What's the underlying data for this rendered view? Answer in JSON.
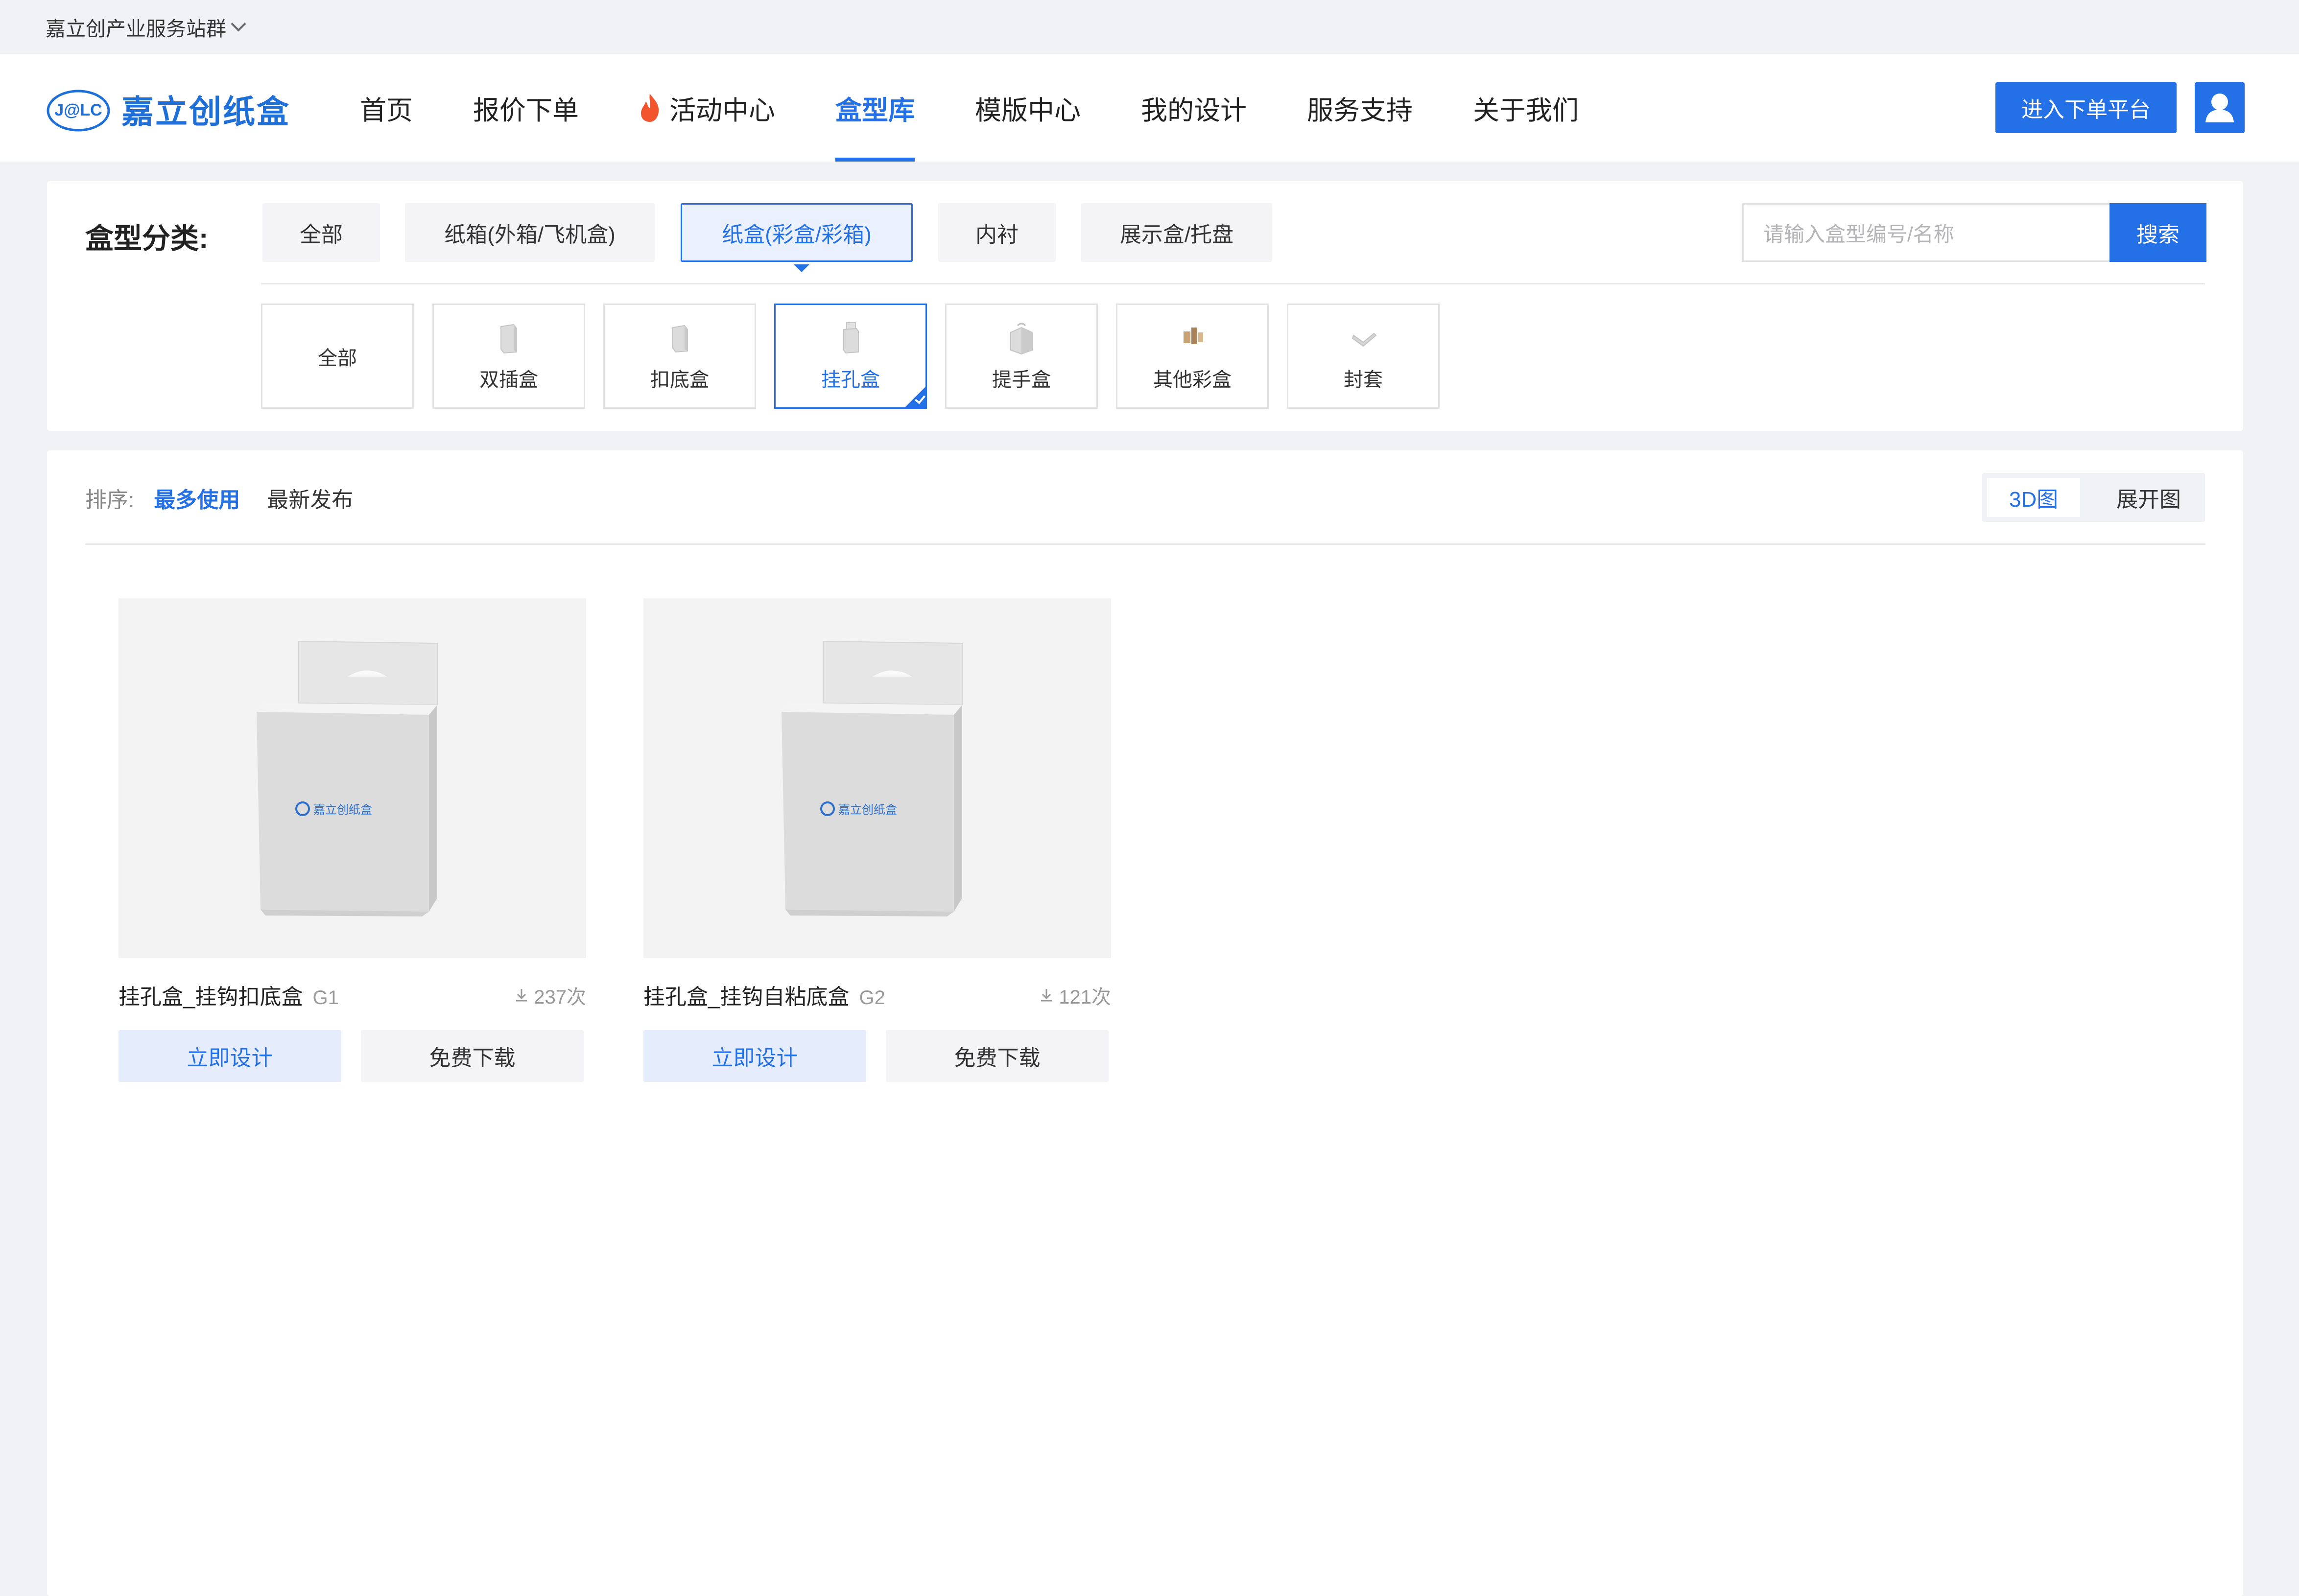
{
  "topbar": {
    "site_group": "嘉立创产业服务站群"
  },
  "brand": {
    "logo_text": "嘉立创纸盒",
    "logo_mark": "J@LC"
  },
  "nav": {
    "items": [
      "首页",
      "报价下单",
      "活动中心",
      "盒型库",
      "模版中心",
      "我的设计",
      "服务支持",
      "关于我们"
    ],
    "active": "盒型库"
  },
  "header": {
    "enter_platform": "进入下单平台"
  },
  "category": {
    "label": "盒型分类:",
    "main": [
      "全部",
      "纸箱(外箱/飞机盒)",
      "纸盒(彩盒/彩箱)",
      "内衬",
      "展示盒/托盘"
    ],
    "active_main": "纸盒(彩盒/彩箱)",
    "search_placeholder": "请输入盒型编号/名称",
    "search_button": "搜索",
    "sub": [
      "全部",
      "双插盒",
      "扣底盒",
      "挂孔盒",
      "提手盒",
      "其他彩盒",
      "封套"
    ],
    "active_sub": "挂孔盒"
  },
  "sort": {
    "label": "排序:",
    "options": [
      "最多使用",
      "最新发布"
    ],
    "active": "最多使用"
  },
  "view": {
    "options": [
      "3D图",
      "展开图"
    ],
    "active": "3D图"
  },
  "products": [
    {
      "name": "挂孔盒_挂钩扣底盒",
      "code": "G1",
      "downloads": "237次",
      "box_brand": "嘉立创纸盒",
      "design_label": "立即设计",
      "download_label": "免费下载"
    },
    {
      "name": "挂孔盒_挂钩自粘底盒",
      "code": "G2",
      "downloads": "121次",
      "box_brand": "嘉立创纸盒",
      "design_label": "立即设计",
      "download_label": "免费下载"
    }
  ],
  "colors": {
    "accent": "#2470e6",
    "page_bg": "#f1f2f5"
  }
}
